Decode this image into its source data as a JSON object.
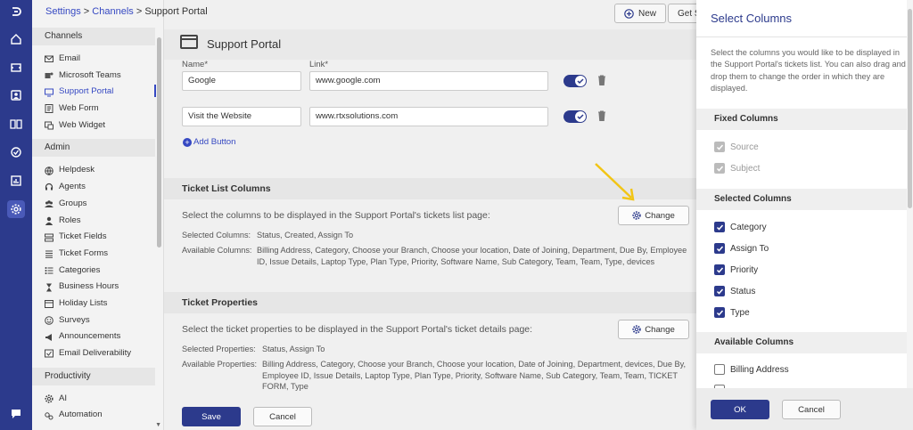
{
  "breadcrumb": {
    "root": "Settings",
    "sep1": " > ",
    "mid": "Channels",
    "sep2": " > ",
    "current": "Support Portal"
  },
  "top_buttons": {
    "new_label": "New",
    "get_label": "Get S"
  },
  "nav": {
    "channels_header": "Channels",
    "channels": [
      {
        "label": "Email",
        "icon": "mail-icon"
      },
      {
        "label": "Microsoft Teams",
        "icon": "teams-icon"
      },
      {
        "label": "Support Portal",
        "icon": "monitor-icon"
      },
      {
        "label": "Web Form",
        "icon": "form-icon"
      },
      {
        "label": "Web Widget",
        "icon": "widget-icon"
      }
    ],
    "admin_header": "Admin",
    "admin": [
      {
        "label": "Helpdesk",
        "icon": "globe-icon"
      },
      {
        "label": "Agents",
        "icon": "headset-icon"
      },
      {
        "label": "Groups",
        "icon": "group-icon"
      },
      {
        "label": "Roles",
        "icon": "user-icon"
      },
      {
        "label": "Ticket Fields",
        "icon": "fields-icon"
      },
      {
        "label": "Ticket Forms",
        "icon": "list-icon"
      },
      {
        "label": "Categories",
        "icon": "categories-icon"
      },
      {
        "label": "Business Hours",
        "icon": "hourglass-icon"
      },
      {
        "label": "Holiday Lists",
        "icon": "calendar-icon"
      },
      {
        "label": "Surveys",
        "icon": "survey-icon"
      },
      {
        "label": "Announcements",
        "icon": "megaphone-icon"
      },
      {
        "label": "Email Deliverability",
        "icon": "mail-check-icon"
      }
    ],
    "productivity_header": "Productivity",
    "productivity": [
      {
        "label": "AI",
        "icon": "gear-icon"
      },
      {
        "label": "Automation",
        "icon": "automation-icon"
      }
    ]
  },
  "page": {
    "title": "Support Portal",
    "name_label": "Name*",
    "link_label": "Link*",
    "links": [
      {
        "name": "Google",
        "link": "www.google.com"
      },
      {
        "name": "Visit the Website",
        "link": "www.rtxsolutions.com"
      }
    ],
    "add_button": "Add Button",
    "ticket_list": {
      "header": "Ticket List Columns",
      "desc": "Select the columns to be displayed in the Support Portal's tickets list page:",
      "change": "Change",
      "selected_label": "Selected Columns:",
      "selected_value": "Status, Created, Assign To",
      "available_label": "Available Columns:",
      "available_value": "Billing Address, Category, Choose your Branch, Choose your location, Date of Joining, Department, Due By, Employee ID, Issue Details, Laptop Type, Plan Type, Priority, Software Name, Sub Category, Team, Team, Type, devices"
    },
    "ticket_props": {
      "header": "Ticket Properties",
      "desc": "Select the ticket properties to be displayed in the Support Portal's ticket details page:",
      "change": "Change",
      "selected_label": "Selected Properties:",
      "selected_value": "Status, Assign To",
      "available_label": "Available Properties:",
      "available_value": "Billing Address, Category, Choose your Branch, Choose your location, Date of Joining, Department, devices, Due By, Employee ID, Issue Details, Laptop Type, Plan Type, Priority, Software Name, Sub Category, Team, Team, TICKET FORM, Type"
    },
    "save": "Save",
    "cancel": "Cancel"
  },
  "dialog": {
    "title": "Select Columns",
    "text": "Select the columns you would like to be displayed in the Support Portal's tickets list. You can also drag and drop them to change the order in which they are displayed.",
    "fixed_header": "Fixed Columns",
    "fixed": [
      "Source",
      "Subject"
    ],
    "selected_header": "Selected Columns",
    "selected": [
      "Category",
      "Assign To",
      "Priority",
      "Status",
      "Type"
    ],
    "available_header": "Available Columns",
    "available": [
      "Billing Address"
    ],
    "ok": "OK",
    "cancel": "Cancel"
  },
  "colors": {
    "brand": "#2c3a8c",
    "link": "#3548c2",
    "arrow": "#f2c515"
  }
}
